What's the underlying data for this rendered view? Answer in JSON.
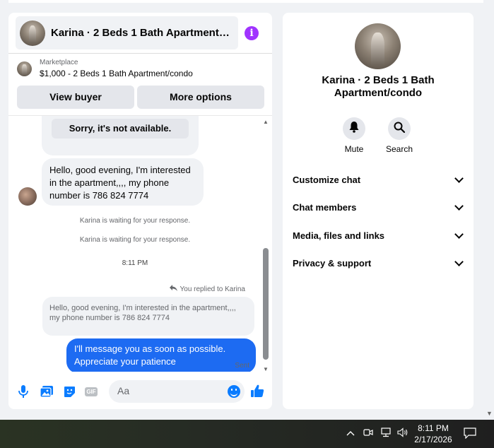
{
  "chat": {
    "title": "Karina · 2 Beds 1 Bath Apartment/condo",
    "listing": {
      "kicker": "Marketplace",
      "price_title": "$1,000 - 2 Beds 1 Bath Apartment/condo"
    },
    "buttons": {
      "view_buyer": "View buyer",
      "more_options": "More options"
    },
    "messages": {
      "card_button": "Sorry, it's not available.",
      "incoming": "Hello, good evening, I'm interested in the apartment,,,, my phone number is 786 824 7774",
      "system_1": "Karina is waiting for your response.",
      "system_2": "Karina is waiting for your response.",
      "timestamp": "8:11 PM",
      "replied_label": "You replied to Karina",
      "quoted": "Hello, good evening, I'm interested in the apartment,,,, my phone number is 786 824 7774",
      "outgoing": "I'll message you as soon as possible. Appreciate your patience",
      "status": "Sent"
    },
    "composer": {
      "placeholder": "Aa",
      "gif_label": "GIF"
    }
  },
  "info": {
    "name": "Karina · 2 Beds 1 Bath Apartment/condo",
    "actions": {
      "mute": "Mute",
      "search": "Search"
    },
    "sections": [
      "Customize chat",
      "Chat members",
      "Media, files and links",
      "Privacy & support"
    ]
  },
  "taskbar": {
    "time": "8:11 PM",
    "date": "2/17/2026"
  },
  "colors": {
    "accent": "#0a7cff",
    "outgoing_bubble": "#1d6bf2",
    "info_icon": "#a033ff"
  }
}
